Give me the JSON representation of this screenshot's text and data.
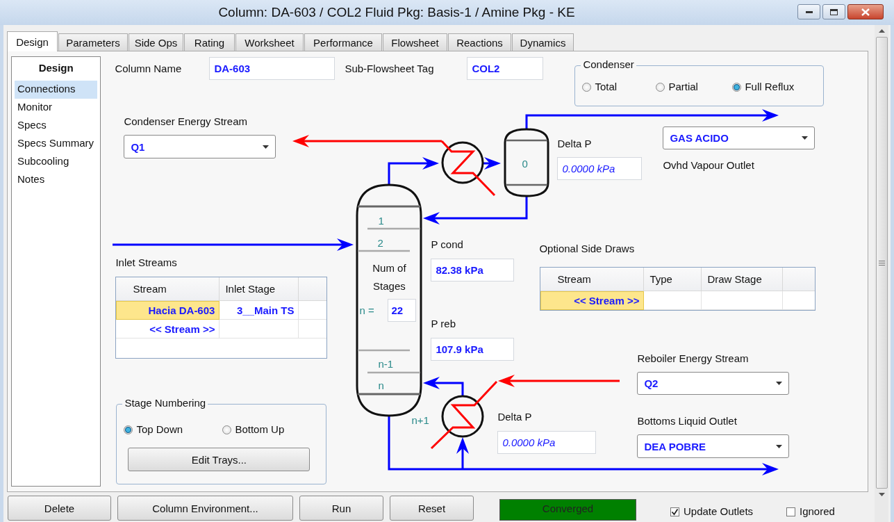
{
  "window": {
    "title": "Column: DA-603 / COL2  Fluid Pkg: Basis-1 / Amine Pkg - KE"
  },
  "tabs": [
    {
      "label": "Design",
      "selected": true
    },
    {
      "label": "Parameters",
      "selected": false
    },
    {
      "label": "Side Ops",
      "selected": false
    },
    {
      "label": "Rating",
      "selected": false
    },
    {
      "label": "Worksheet",
      "selected": false
    },
    {
      "label": "Performance",
      "selected": false
    },
    {
      "label": "Flowsheet",
      "selected": false
    },
    {
      "label": "Reactions",
      "selected": false
    },
    {
      "label": "Dynamics",
      "selected": false
    }
  ],
  "nav": {
    "header": "Design",
    "items": [
      {
        "label": "Connections",
        "selected": true
      },
      {
        "label": "Monitor",
        "selected": false
      },
      {
        "label": "Specs",
        "selected": false
      },
      {
        "label": "Specs Summary",
        "selected": false
      },
      {
        "label": "Subcooling",
        "selected": false
      },
      {
        "label": "Notes",
        "selected": false
      }
    ]
  },
  "column_name": {
    "label": "Column Name",
    "value": "DA-603"
  },
  "sub_flowsheet_tag": {
    "label": "Sub-Flowsheet Tag",
    "value": "COL2"
  },
  "condenser": {
    "title": "Condenser",
    "options": [
      {
        "label": "Total",
        "selected": false
      },
      {
        "label": "Partial",
        "selected": false
      },
      {
        "label": "Full Reflux",
        "selected": true
      }
    ]
  },
  "condenser_energy_stream": {
    "label": "Condenser Energy Stream",
    "value": "Q1"
  },
  "condenser_delta_p": {
    "label": "Delta P",
    "value": "0.0000 kPa"
  },
  "ovhd_vapour_outlet": {
    "label": "Ovhd Vapour Outlet",
    "value": "GAS ACIDO"
  },
  "diagram": {
    "drum_stage": "0",
    "top_stages": [
      "1",
      "2"
    ],
    "num_stages_label": "Num of Stages",
    "n_label": "n =",
    "num_stages": "22",
    "bottom_stages": [
      "n-1",
      "n"
    ],
    "reboiler_stage": "n+1"
  },
  "p_cond": {
    "label": "P cond",
    "value": "82.38 kPa"
  },
  "p_reb": {
    "label": "P reb",
    "value": "107.9 kPa"
  },
  "inlet_streams": {
    "title": "Inlet Streams",
    "columns": [
      "Stream",
      "Inlet Stage"
    ],
    "rows": [
      {
        "stream": "Hacia DA-603",
        "stage": "3__Main TS",
        "selected": true
      },
      {
        "stream": "<< Stream >>",
        "selected": false
      }
    ]
  },
  "side_draws": {
    "title": "Optional Side Draws",
    "columns": [
      "Stream",
      "Type",
      "Draw Stage"
    ],
    "rows": [
      {
        "stream": "<< Stream >>",
        "selected": true
      }
    ]
  },
  "stage_numbering": {
    "title": "Stage Numbering",
    "options": [
      {
        "label": "Top Down",
        "selected": true
      },
      {
        "label": "Bottom Up",
        "selected": false
      }
    ],
    "button": "Edit Trays..."
  },
  "reboiler_energy_stream": {
    "label": "Reboiler Energy Stream",
    "value": "Q2"
  },
  "reboiler_delta_p": {
    "label": "Delta P",
    "value": "0.0000 kPa"
  },
  "bottoms_liquid_outlet": {
    "label": "Bottoms Liquid Outlet",
    "value": "DEA POBRE"
  },
  "footer": {
    "buttons": [
      "Delete",
      "Column Environment...",
      "Run",
      "Reset"
    ],
    "status": {
      "text": "Converged",
      "kind": "ok"
    },
    "checkboxes": [
      {
        "label": "Update Outlets",
        "checked": true
      },
      {
        "label": "Ignored",
        "checked": false
      }
    ]
  }
}
